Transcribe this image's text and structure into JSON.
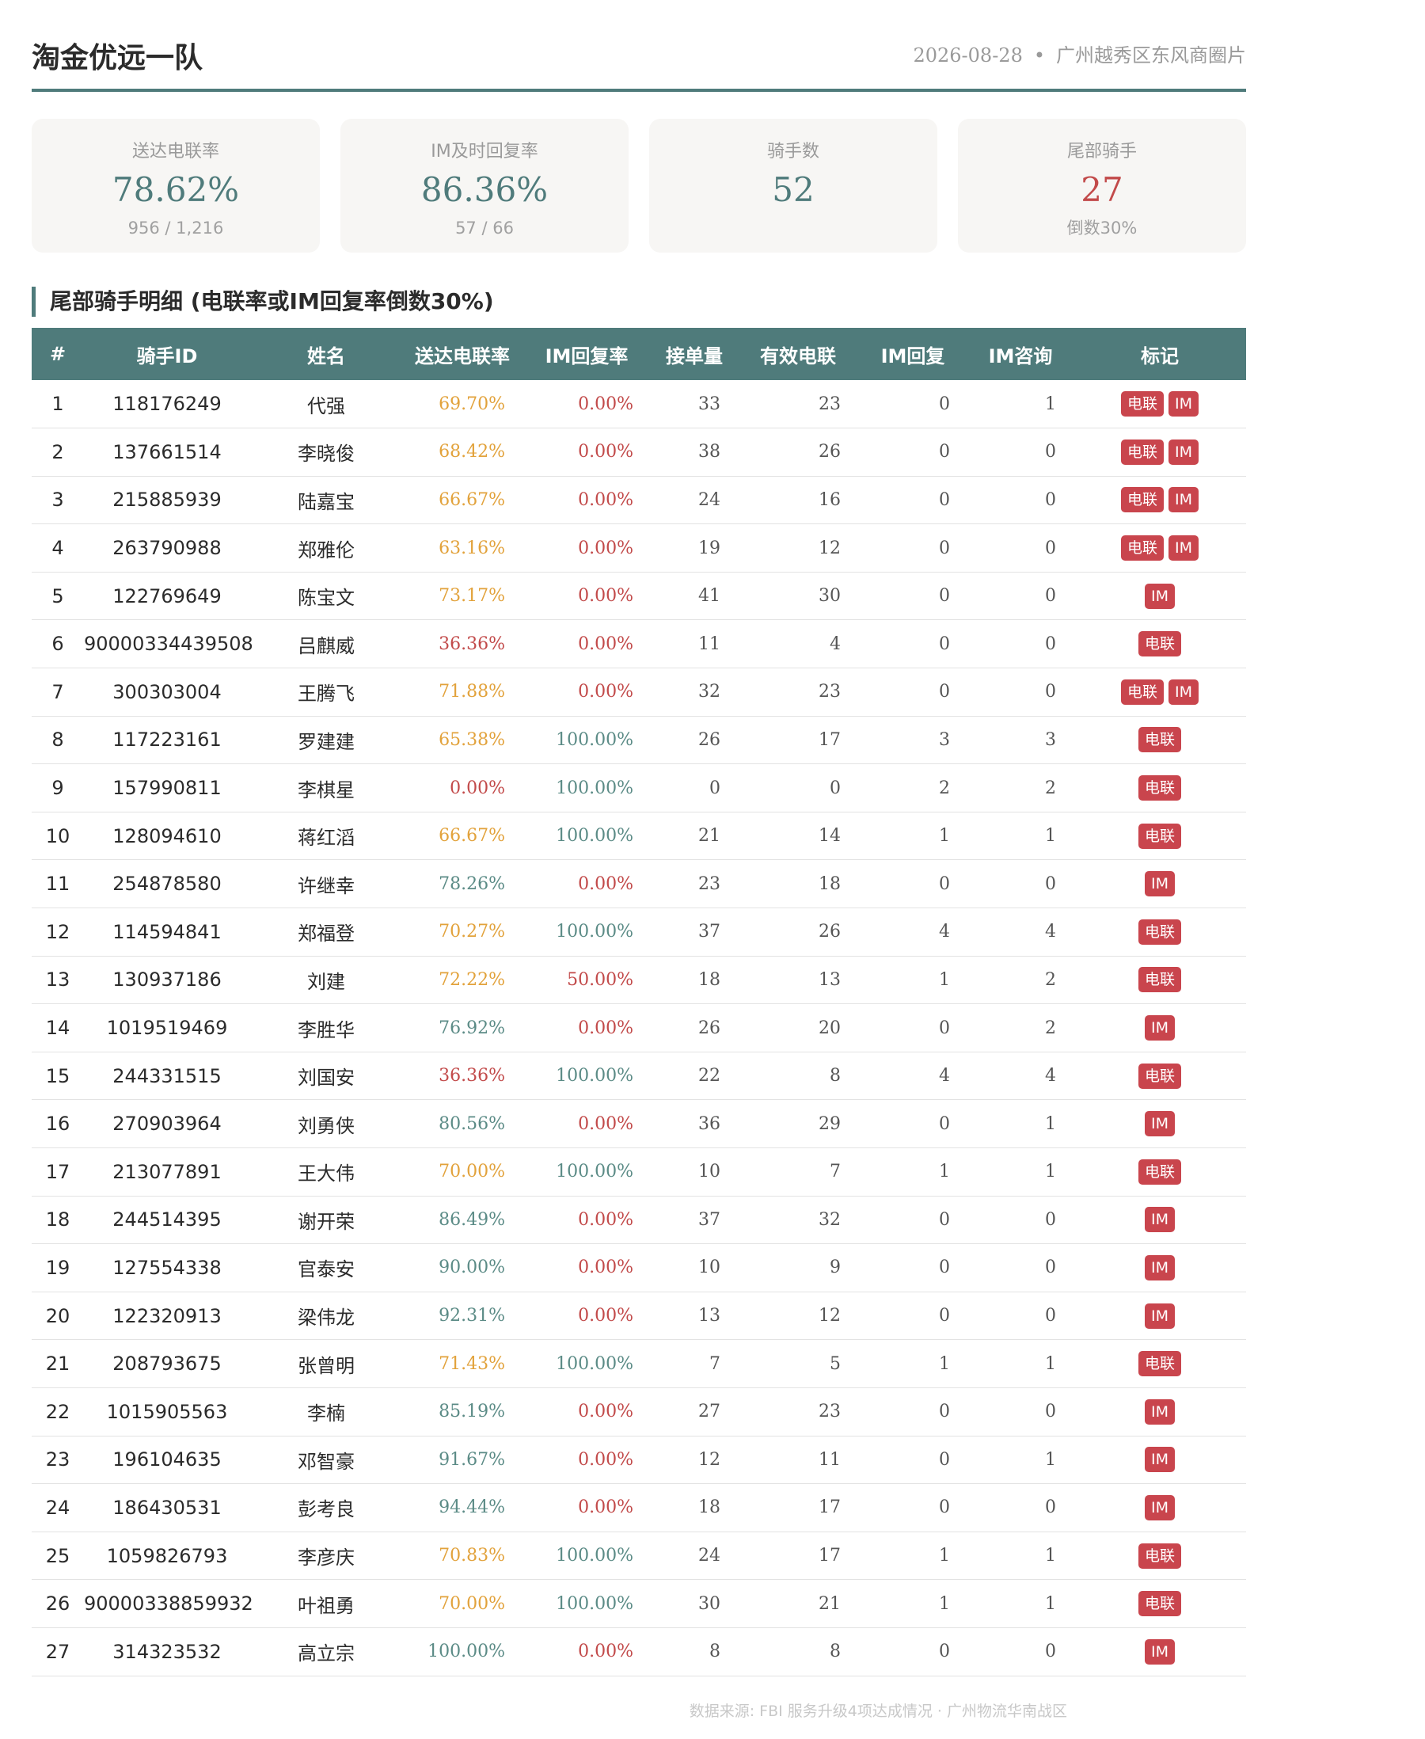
{
  "header": {
    "title": "淘金优远一队",
    "date": "2026-08-28",
    "separator": "•",
    "area": "广州越秀区东风商圈片"
  },
  "cards": [
    {
      "label": "送达电联率",
      "value": "78.62%",
      "sub": "956 / 1,216",
      "tone": "green"
    },
    {
      "label": "IM及时回复率",
      "value": "86.36%",
      "sub": "57 / 66",
      "tone": "green"
    },
    {
      "label": "骑手数",
      "value": "52",
      "sub": "",
      "tone": "green"
    },
    {
      "label": "尾部骑手",
      "value": "27",
      "sub": "倒数30%",
      "tone": "red"
    }
  ],
  "section": {
    "title": "尾部骑手明细 (电联率或IM回复率倒数30%)"
  },
  "table": {
    "headers": [
      "#",
      "骑手ID",
      "姓名",
      "送达电联率",
      "IM回复率",
      "接单量",
      "有效电联",
      "IM回复",
      "IM咨询",
      "标记"
    ],
    "rows": [
      {
        "idx": "1",
        "id": "118176249",
        "name": "代强",
        "rate": "69.70%",
        "rate_tone": "orange",
        "im": "0.00%",
        "im_tone": "red",
        "orders": "33",
        "calls": "23",
        "im_reply": "0",
        "im_consult": "1",
        "tags": [
          "电联",
          "IM"
        ]
      },
      {
        "idx": "2",
        "id": "137661514",
        "name": "李晓俊",
        "rate": "68.42%",
        "rate_tone": "orange",
        "im": "0.00%",
        "im_tone": "red",
        "orders": "38",
        "calls": "26",
        "im_reply": "0",
        "im_consult": "0",
        "tags": [
          "电联",
          "IM"
        ]
      },
      {
        "idx": "3",
        "id": "215885939",
        "name": "陆嘉宝",
        "rate": "66.67%",
        "rate_tone": "orange",
        "im": "0.00%",
        "im_tone": "red",
        "orders": "24",
        "calls": "16",
        "im_reply": "0",
        "im_consult": "0",
        "tags": [
          "电联",
          "IM"
        ]
      },
      {
        "idx": "4",
        "id": "263790988",
        "name": "郑雅伦",
        "rate": "63.16%",
        "rate_tone": "orange",
        "im": "0.00%",
        "im_tone": "red",
        "orders": "19",
        "calls": "12",
        "im_reply": "0",
        "im_consult": "0",
        "tags": [
          "电联",
          "IM"
        ]
      },
      {
        "idx": "5",
        "id": "122769649",
        "name": "陈宝文",
        "rate": "73.17%",
        "rate_tone": "orange",
        "im": "0.00%",
        "im_tone": "red",
        "orders": "41",
        "calls": "30",
        "im_reply": "0",
        "im_consult": "0",
        "tags": [
          "IM"
        ]
      },
      {
        "idx": "6",
        "id": "90000334439508",
        "name": "吕麒威",
        "rate": "36.36%",
        "rate_tone": "red",
        "im": "0.00%",
        "im_tone": "red",
        "orders": "11",
        "calls": "4",
        "im_reply": "0",
        "im_consult": "0",
        "tags": [
          "电联"
        ]
      },
      {
        "idx": "7",
        "id": "300303004",
        "name": "王腾飞",
        "rate": "71.88%",
        "rate_tone": "orange",
        "im": "0.00%",
        "im_tone": "red",
        "orders": "32",
        "calls": "23",
        "im_reply": "0",
        "im_consult": "0",
        "tags": [
          "电联",
          "IM"
        ]
      },
      {
        "idx": "8",
        "id": "117223161",
        "name": "罗建建",
        "rate": "65.38%",
        "rate_tone": "orange",
        "im": "100.00%",
        "im_tone": "green",
        "orders": "26",
        "calls": "17",
        "im_reply": "3",
        "im_consult": "3",
        "tags": [
          "电联"
        ]
      },
      {
        "idx": "9",
        "id": "157990811",
        "name": "李棋星",
        "rate": "0.00%",
        "rate_tone": "red",
        "im": "100.00%",
        "im_tone": "green",
        "orders": "0",
        "calls": "0",
        "im_reply": "2",
        "im_consult": "2",
        "tags": [
          "电联"
        ]
      },
      {
        "idx": "10",
        "id": "128094610",
        "name": "蒋红滔",
        "rate": "66.67%",
        "rate_tone": "orange",
        "im": "100.00%",
        "im_tone": "green",
        "orders": "21",
        "calls": "14",
        "im_reply": "1",
        "im_consult": "1",
        "tags": [
          "电联"
        ]
      },
      {
        "idx": "11",
        "id": "254878580",
        "name": "许继幸",
        "rate": "78.26%",
        "rate_tone": "green",
        "im": "0.00%",
        "im_tone": "red",
        "orders": "23",
        "calls": "18",
        "im_reply": "0",
        "im_consult": "0",
        "tags": [
          "IM"
        ]
      },
      {
        "idx": "12",
        "id": "114594841",
        "name": "郑福登",
        "rate": "70.27%",
        "rate_tone": "orange",
        "im": "100.00%",
        "im_tone": "green",
        "orders": "37",
        "calls": "26",
        "im_reply": "4",
        "im_consult": "4",
        "tags": [
          "电联"
        ]
      },
      {
        "idx": "13",
        "id": "130937186",
        "name": "刘建",
        "rate": "72.22%",
        "rate_tone": "orange",
        "im": "50.00%",
        "im_tone": "red",
        "orders": "18",
        "calls": "13",
        "im_reply": "1",
        "im_consult": "2",
        "tags": [
          "电联"
        ]
      },
      {
        "idx": "14",
        "id": "1019519469",
        "name": "李胜华",
        "rate": "76.92%",
        "rate_tone": "green",
        "im": "0.00%",
        "im_tone": "red",
        "orders": "26",
        "calls": "20",
        "im_reply": "0",
        "im_consult": "2",
        "tags": [
          "IM"
        ]
      },
      {
        "idx": "15",
        "id": "244331515",
        "name": "刘国安",
        "rate": "36.36%",
        "rate_tone": "red",
        "im": "100.00%",
        "im_tone": "green",
        "orders": "22",
        "calls": "8",
        "im_reply": "4",
        "im_consult": "4",
        "tags": [
          "电联"
        ]
      },
      {
        "idx": "16",
        "id": "270903964",
        "name": "刘勇侠",
        "rate": "80.56%",
        "rate_tone": "green",
        "im": "0.00%",
        "im_tone": "red",
        "orders": "36",
        "calls": "29",
        "im_reply": "0",
        "im_consult": "1",
        "tags": [
          "IM"
        ]
      },
      {
        "idx": "17",
        "id": "213077891",
        "name": "王大伟",
        "rate": "70.00%",
        "rate_tone": "orange",
        "im": "100.00%",
        "im_tone": "green",
        "orders": "10",
        "calls": "7",
        "im_reply": "1",
        "im_consult": "1",
        "tags": [
          "电联"
        ]
      },
      {
        "idx": "18",
        "id": "244514395",
        "name": "谢开荣",
        "rate": "86.49%",
        "rate_tone": "green",
        "im": "0.00%",
        "im_tone": "red",
        "orders": "37",
        "calls": "32",
        "im_reply": "0",
        "im_consult": "0",
        "tags": [
          "IM"
        ]
      },
      {
        "idx": "19",
        "id": "127554338",
        "name": "官泰安",
        "rate": "90.00%",
        "rate_tone": "green",
        "im": "0.00%",
        "im_tone": "red",
        "orders": "10",
        "calls": "9",
        "im_reply": "0",
        "im_consult": "0",
        "tags": [
          "IM"
        ]
      },
      {
        "idx": "20",
        "id": "122320913",
        "name": "梁伟龙",
        "rate": "92.31%",
        "rate_tone": "green",
        "im": "0.00%",
        "im_tone": "red",
        "orders": "13",
        "calls": "12",
        "im_reply": "0",
        "im_consult": "0",
        "tags": [
          "IM"
        ]
      },
      {
        "idx": "21",
        "id": "208793675",
        "name": "张曾明",
        "rate": "71.43%",
        "rate_tone": "orange",
        "im": "100.00%",
        "im_tone": "green",
        "orders": "7",
        "calls": "5",
        "im_reply": "1",
        "im_consult": "1",
        "tags": [
          "电联"
        ]
      },
      {
        "idx": "22",
        "id": "1015905563",
        "name": "李楠",
        "rate": "85.19%",
        "rate_tone": "green",
        "im": "0.00%",
        "im_tone": "red",
        "orders": "27",
        "calls": "23",
        "im_reply": "0",
        "im_consult": "0",
        "tags": [
          "IM"
        ]
      },
      {
        "idx": "23",
        "id": "196104635",
        "name": "邓智豪",
        "rate": "91.67%",
        "rate_tone": "green",
        "im": "0.00%",
        "im_tone": "red",
        "orders": "12",
        "calls": "11",
        "im_reply": "0",
        "im_consult": "1",
        "tags": [
          "IM"
        ]
      },
      {
        "idx": "24",
        "id": "186430531",
        "name": "彭考良",
        "rate": "94.44%",
        "rate_tone": "green",
        "im": "0.00%",
        "im_tone": "red",
        "orders": "18",
        "calls": "17",
        "im_reply": "0",
        "im_consult": "0",
        "tags": [
          "IM"
        ]
      },
      {
        "idx": "25",
        "id": "1059826793",
        "name": "李彦庆",
        "rate": "70.83%",
        "rate_tone": "orange",
        "im": "100.00%",
        "im_tone": "green",
        "orders": "24",
        "calls": "17",
        "im_reply": "1",
        "im_consult": "1",
        "tags": [
          "电联"
        ]
      },
      {
        "idx": "26",
        "id": "90000338859932",
        "name": "叶祖勇",
        "rate": "70.00%",
        "rate_tone": "orange",
        "im": "100.00%",
        "im_tone": "green",
        "orders": "30",
        "calls": "21",
        "im_reply": "1",
        "im_consult": "1",
        "tags": [
          "电联"
        ]
      },
      {
        "idx": "27",
        "id": "314323532",
        "name": "高立宗",
        "rate": "100.00%",
        "rate_tone": "green",
        "im": "0.00%",
        "im_tone": "red",
        "orders": "8",
        "calls": "8",
        "im_reply": "0",
        "im_consult": "0",
        "tags": [
          "IM"
        ]
      }
    ]
  },
  "footer": {
    "source": "数据来源: FBI 服务升级4项达成情况 · 广州物流华南战区"
  },
  "colors": {
    "accent": "#4f7b7b",
    "tag_red": "#c9454d",
    "pct_green": "#5b8b86",
    "pct_orange": "#e2a23b",
    "pct_red": "#c24a4a"
  }
}
